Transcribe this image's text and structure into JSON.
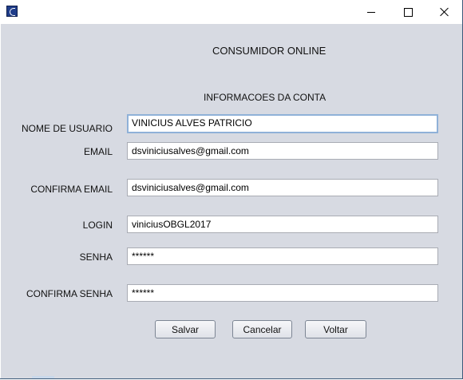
{
  "window": {
    "icon": "java-cup-icon"
  },
  "header": {
    "title": "CONSUMIDOR ONLINE",
    "subtitle": "INFORMACOES DA CONTA"
  },
  "form": {
    "username_label": "NOME DE USUARIO",
    "username_value": "VINICIUS ALVES PATRICIO",
    "email_label": "EMAIL",
    "email_value": "dsviniciusalves@gmail.com",
    "confirm_email_label": "CONFIRMA EMAIL",
    "confirm_email_value": "dsviniciusalves@gmail.com",
    "login_label": "LOGIN",
    "login_value": "viniciusOBGL2017",
    "password_label": "SENHA",
    "password_value": "******",
    "confirm_password_label": "CONFIRMA SENHA",
    "confirm_password_value": "******"
  },
  "buttons": {
    "save": "Salvar",
    "cancel": "Cancelar",
    "back": "Voltar"
  }
}
